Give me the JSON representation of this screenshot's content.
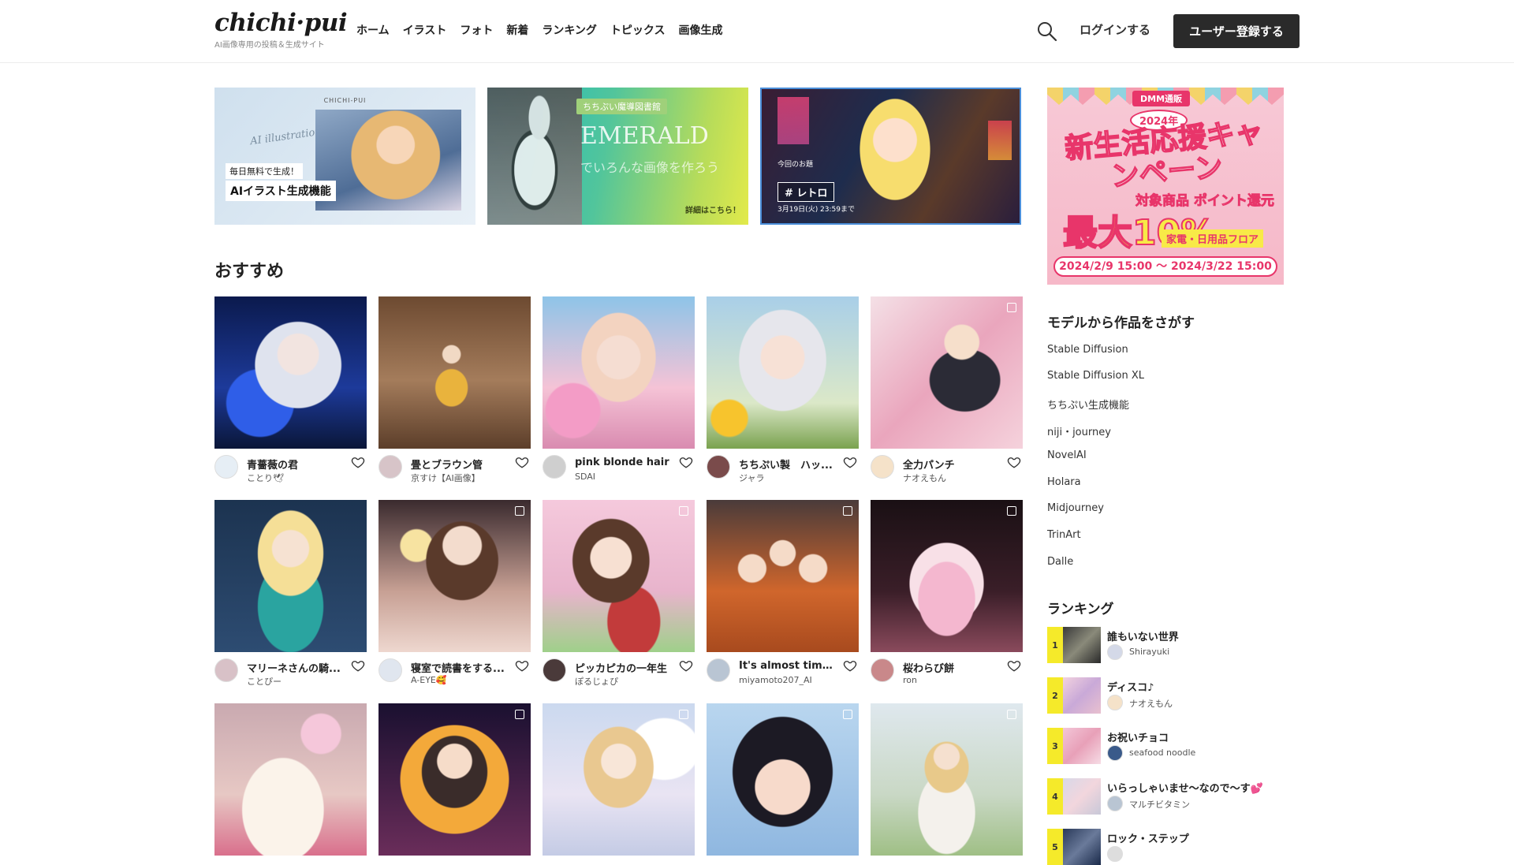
{
  "header": {
    "logo": "chichi·pui",
    "tagline": "AI画像専用の投稿＆生成サイト",
    "nav": [
      "ホーム",
      "イラスト",
      "フォト",
      "新着",
      "ランキング",
      "トピックス",
      "画像生成"
    ],
    "login": "ログインする",
    "register": "ユーザー登録する"
  },
  "banners": {
    "b1": {
      "brand": "CHICHI-PUI",
      "script": "AI illustration",
      "tag1": "毎日無料で生成！",
      "tag2": "AIイラスト生成機能"
    },
    "b2": {
      "badge": "ちちぷい魔導図書館",
      "title": "EMERALD",
      "sub": "でいろんな画像を作ろう",
      "more": "詳細はこちら！"
    },
    "b3": {
      "label": "今回のお題",
      "tag": "# レトロ",
      "date": "3月19日(火) 23:59まで"
    }
  },
  "recommend": {
    "title": "おすすめ",
    "cards": [
      {
        "title": "青薔薇の君",
        "user": "ことり🕊",
        "multi": false
      },
      {
        "title": "畳とブラウン管",
        "user": "京すけ【AI画像】",
        "multi": false
      },
      {
        "title": "pink blonde hair",
        "user": "SDAI",
        "multi": false
      },
      {
        "title": "ちちぷい製　ハッ...",
        "user": "ジャラ",
        "multi": false
      },
      {
        "title": "全力パンチ",
        "user": "ナオえもん",
        "multi": true
      },
      {
        "title": "マリーネさんの騎...",
        "user": "ことぴー",
        "multi": false
      },
      {
        "title": "寝室で読書をする...",
        "user": "A-EYE🥰",
        "multi": true
      },
      {
        "title": "ピッカピカの一年生",
        "user": "ぽるじょぴ",
        "multi": true
      },
      {
        "title": "It's almost time to ...",
        "user": "miyamoto207_AI",
        "multi": true
      },
      {
        "title": "桜わらび餅",
        "user": "ron",
        "multi": true
      },
      {
        "title": "",
        "user": "",
        "multi": false
      },
      {
        "title": "",
        "user": "",
        "multi": true
      },
      {
        "title": "",
        "user": "",
        "multi": true
      },
      {
        "title": "",
        "user": "",
        "multi": true
      },
      {
        "title": "",
        "user": "",
        "multi": true
      }
    ]
  },
  "ad": {
    "badge": "DMM通販",
    "year": "2024年",
    "main": "新生活応援キャンペーン",
    "points": "対象商品 ポイント還元",
    "max": "最大10%",
    "floor": "家電・日用品フロア",
    "period": "2024/2/9 15:00 ～ 2024/3/22 15:00"
  },
  "models": {
    "title": "モデルから作品をさがす",
    "items": [
      "Stable Diffusion",
      "Stable Diffusion XL",
      "ちちぷい生成機能",
      "niji・journey",
      "NovelAI",
      "Holara",
      "Midjourney",
      "TrinArt",
      "Dalle"
    ]
  },
  "ranking": {
    "title": "ランキング",
    "items": [
      {
        "rank": "1",
        "title": "誰もいない世界",
        "user": "Shirayuki"
      },
      {
        "rank": "2",
        "title": "ディスコ♪",
        "user": "ナオえもん"
      },
      {
        "rank": "3",
        "title": "お祝いチョコ",
        "user": "seafood noodle"
      },
      {
        "rank": "4",
        "title": "いらっしゃいませ〜なので〜す💕",
        "user": "マルチビタミン"
      },
      {
        "rank": "5",
        "title": "ロック・ステップ",
        "user": ""
      }
    ]
  },
  "colors": {
    "accent": "#2a2a2a",
    "rank_badge": "#f5ea2a",
    "ad_pink": "#e8356a"
  }
}
